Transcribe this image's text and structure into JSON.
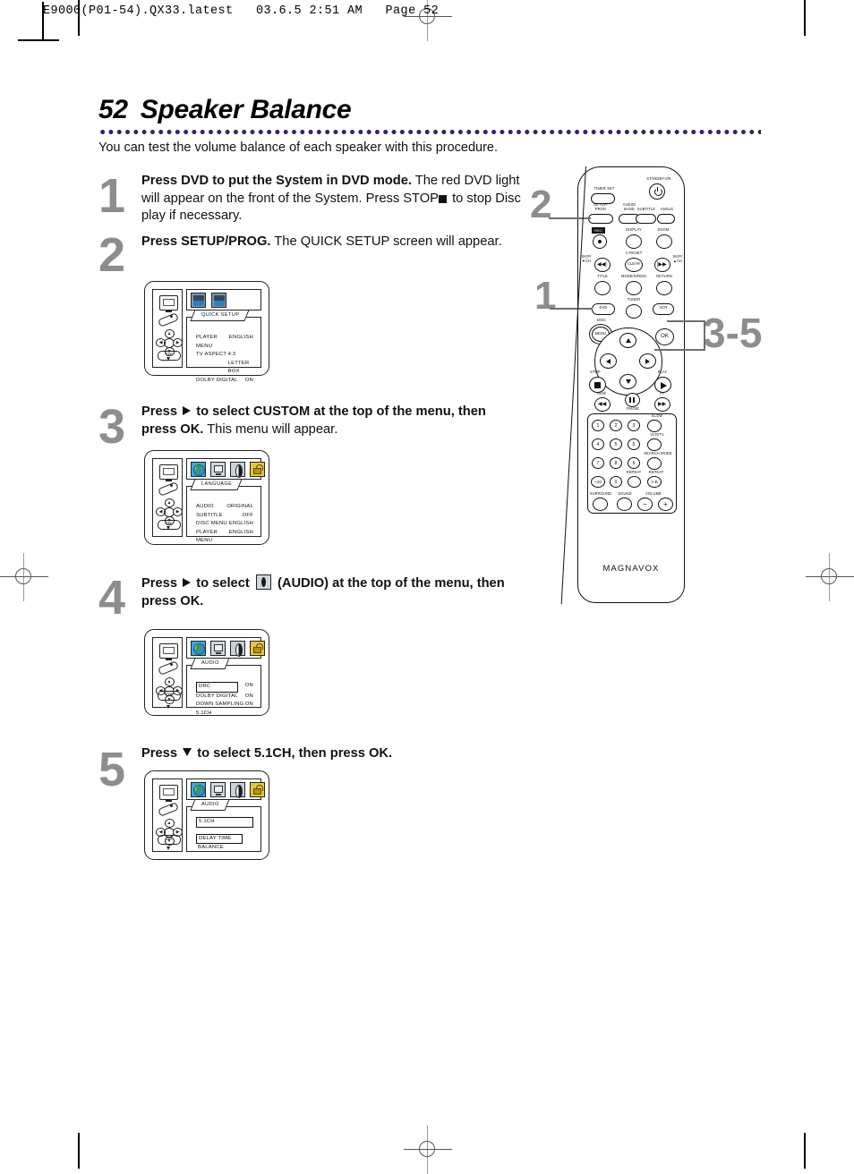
{
  "print_header": "E9000(P01-54).QX33.latest   03.6.5 2:51 AM   Page 52",
  "page": {
    "number": "52",
    "title": "Speaker Balance",
    "intro": "You can test the volume balance of each speaker with this procedure."
  },
  "steps": [
    {
      "number": "1",
      "parts": [
        {
          "bold": "Press DVD to put the System in DVD mode."
        },
        {
          "text": " The red DVD light will appear on the front of the System. Press STOP"
        },
        {
          "icon": "stop-square"
        },
        {
          "text": " to stop Disc play if necessary."
        }
      ]
    },
    {
      "number": "2",
      "parts": [
        {
          "bold": "Press SETUP/PROG."
        },
        {
          "text": " The QUICK SETUP screen will appear."
        }
      ]
    },
    {
      "number": "3",
      "parts": [
        {
          "bold": "Press "
        },
        {
          "icon": "right-triangle"
        },
        {
          "bold": " to select CUSTOM at the top of the menu, then press OK."
        },
        {
          "text": " This menu will appear."
        }
      ]
    },
    {
      "number": "4",
      "parts": [
        {
          "bold": "Press "
        },
        {
          "icon": "right-triangle"
        },
        {
          "bold": " to select "
        },
        {
          "icon": "audio-icon"
        },
        {
          "bold": " (AUDIO) at the top of the menu, then press OK."
        }
      ]
    },
    {
      "number": "5",
      "parts": [
        {
          "bold": "Press "
        },
        {
          "icon": "down-triangle"
        },
        {
          "bold": " to select 5.1CH, then press OK."
        }
      ]
    }
  ],
  "screens": [
    {
      "id": "quick-setup",
      "tab": "QUICK SETUP",
      "icons": [
        "small-blue-1",
        "small-blue-2"
      ],
      "rows": [
        {
          "key": "PLAYER MENU",
          "value": "ENGLISH",
          "highlight": false
        },
        {
          "key": "TV ASPECT",
          "value": "4:3 LETTER BOX",
          "highlight": false
        },
        {
          "key": "DOLBY DIGITAL",
          "value": "ON",
          "highlight": false
        }
      ]
    },
    {
      "id": "language",
      "tab": "LANGUAGE",
      "icons": [
        "globe-icon",
        "tv-icon",
        "audio-icon",
        "lock-icon"
      ],
      "rows": [
        {
          "key": "AUDIO",
          "value": "ORIGINAL",
          "highlight": false
        },
        {
          "key": "SUBTITLE",
          "value": "OFF",
          "highlight": false
        },
        {
          "key": "DISC MENU",
          "value": "ENGLISH",
          "highlight": false
        },
        {
          "key": "PLAYER MENU",
          "value": "ENGLISH",
          "highlight": false
        }
      ]
    },
    {
      "id": "audio-drc",
      "tab": "AUDIO",
      "icons": [
        "globe-icon",
        "tv-icon",
        "audio-icon",
        "lock-icon"
      ],
      "rows": [
        {
          "key": "DRC",
          "value": "ON",
          "highlight": true
        },
        {
          "key": "DOLBY DIGITAL",
          "value": "ON",
          "highlight": false
        },
        {
          "key": "DOWN SAMPLING",
          "value": "ON",
          "highlight": false
        },
        {
          "key": "5.1CH",
          "value": "",
          "highlight": false
        }
      ]
    },
    {
      "id": "audio-51ch",
      "tab": "AUDIO",
      "icons": [
        "globe-icon",
        "tv-icon",
        "audio-icon",
        "lock-icon"
      ],
      "rows": [
        {
          "key": "5.1CH",
          "value": "",
          "highlight": true,
          "wide": true
        },
        {
          "key": "",
          "value": "",
          "spacer": true
        },
        {
          "key": "DELAY TIME",
          "value": "",
          "highlight": true
        },
        {
          "key": "BALANCE",
          "value": "",
          "highlight": false
        }
      ]
    }
  ],
  "osd_sidebar": {
    "tv_icon": "tv-icon",
    "remote_icon": "remote-icon",
    "dpad_icon": "dpad-icon",
    "ok_label": "OK"
  },
  "remote": {
    "brand": "MAGNAVOX",
    "top_labels": {
      "timer_set": "TIMER SET",
      "standby": "STANDBY-ON",
      "setup_prog": "SETUP/\nPROG",
      "audio_band": "AUDIO/\nBAND",
      "subtitle": "SUBTITLE",
      "angle": "ANGLE",
      "rec": "REC",
      "display": "DISPLAY",
      "zoom": "ZOOM",
      "c_reset": "C-RESET",
      "clear": "CLEAR",
      "skip_down": "SKIP/\n▼CH",
      "skip_up": "SKIP/\n▲CH",
      "title": "TITLE",
      "mode_speed": "MODE/SPEED",
      "return": "RETURN",
      "dvd": "DVD",
      "tuner": "TUNER",
      "vcr": "VCR",
      "disc": "DISC",
      "menu": "MENU",
      "ok": "OK",
      "stop": "STOP",
      "play": "PLAY",
      "rew": "REW",
      "pause": "PAUSE",
      "ff": "FF"
    },
    "keypad": {
      "numbers": [
        "1",
        "2",
        "3",
        "4",
        "5",
        "6",
        "7",
        "8",
        "9",
        "+10",
        "0"
      ],
      "slow": "SLOW",
      "vcr_tv": "VCR/TV",
      "search_mode": "SEARCH MODE",
      "repeat": "REPEAT",
      "repeat_ab": "REPEAT",
      "repeat_ab_key": "A-B",
      "surround": "SURROUND",
      "sound": "SOUND",
      "volume": "VOLUME",
      "volume_minus": "–",
      "volume_plus": "+"
    }
  },
  "callouts": [
    {
      "label": "2",
      "target": "setup-prog-button"
    },
    {
      "label": "1",
      "target": "dvd-button"
    },
    {
      "label": "3-5",
      "target": "ok-and-navigation-pad"
    }
  ]
}
